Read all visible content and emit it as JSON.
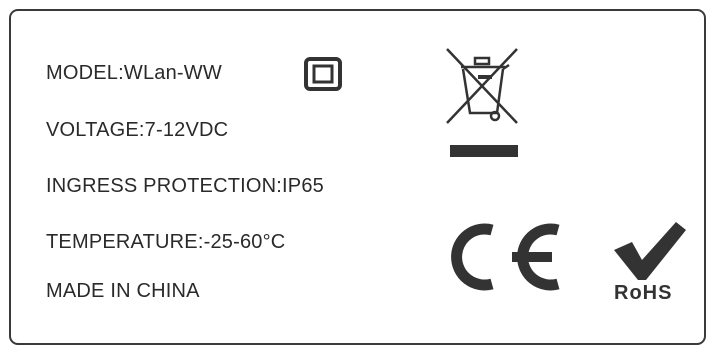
{
  "label": {
    "lines": [
      "MODEL:WLan-WW",
      "VOLTAGE:7-12VDC",
      "INGRESS PROTECTION:IP65",
      "TEMPERATURE:-25-60°C",
      "MADE IN CHINA"
    ],
    "rohs_text": "RoHS"
  },
  "symbols": {
    "indoor_icon": "indoor-use-square-icon",
    "weee_icon": "crossed-out-wheelie-bin-icon",
    "ce_icon": "ce-mark-icon",
    "rohs_icon": "rohs-check-icon"
  },
  "colors": {
    "ink": "#333333",
    "border": "#3a3a3a"
  }
}
